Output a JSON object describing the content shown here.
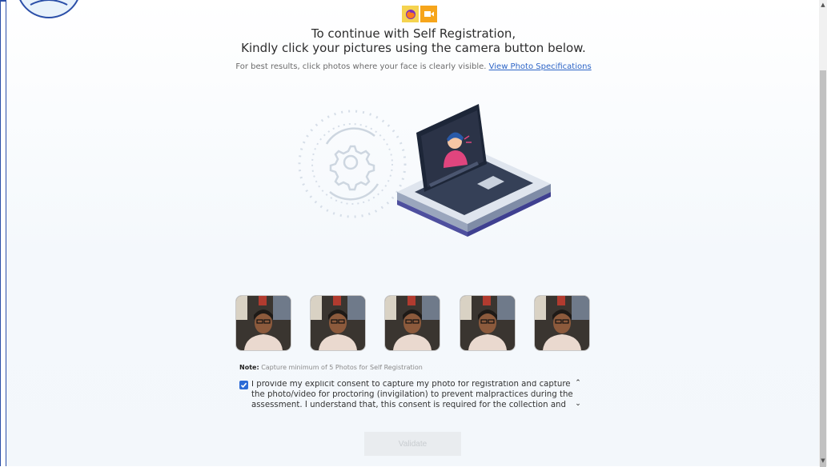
{
  "header": {
    "title_line1": "To continue with Self Registration,",
    "title_line2": "Kindly click your pictures using the camera button below.",
    "hint_text": "For best results, click photos where your face is clearly visible.",
    "hint_link": "View Photo Specifications"
  },
  "indicators": {
    "browser_icon": "firefox-icon",
    "camera_icon": "camera-sharing-icon"
  },
  "photos": [
    {
      "label": "captured-photo-1"
    },
    {
      "label": "captured-photo-2"
    },
    {
      "label": "captured-photo-3"
    },
    {
      "label": "captured-photo-4"
    },
    {
      "label": "captured-photo-5"
    }
  ],
  "note": {
    "label": "Note:",
    "text": "Capture minimum of 5 Photos for Self Registration"
  },
  "consent": {
    "checked": true,
    "text": "I provide my explicit consent to capture my photo for registration and capture the photo/video for proctoring (invigilation) to prevent malpractices during the assessment. I understand that, this consent is required for the collection and use of personal data for"
  },
  "actions": {
    "validate_label": "Validate"
  },
  "colors": {
    "accent": "#2c64c6",
    "frame": "#2b4fa8",
    "disabled_bg": "#e9ecef"
  }
}
